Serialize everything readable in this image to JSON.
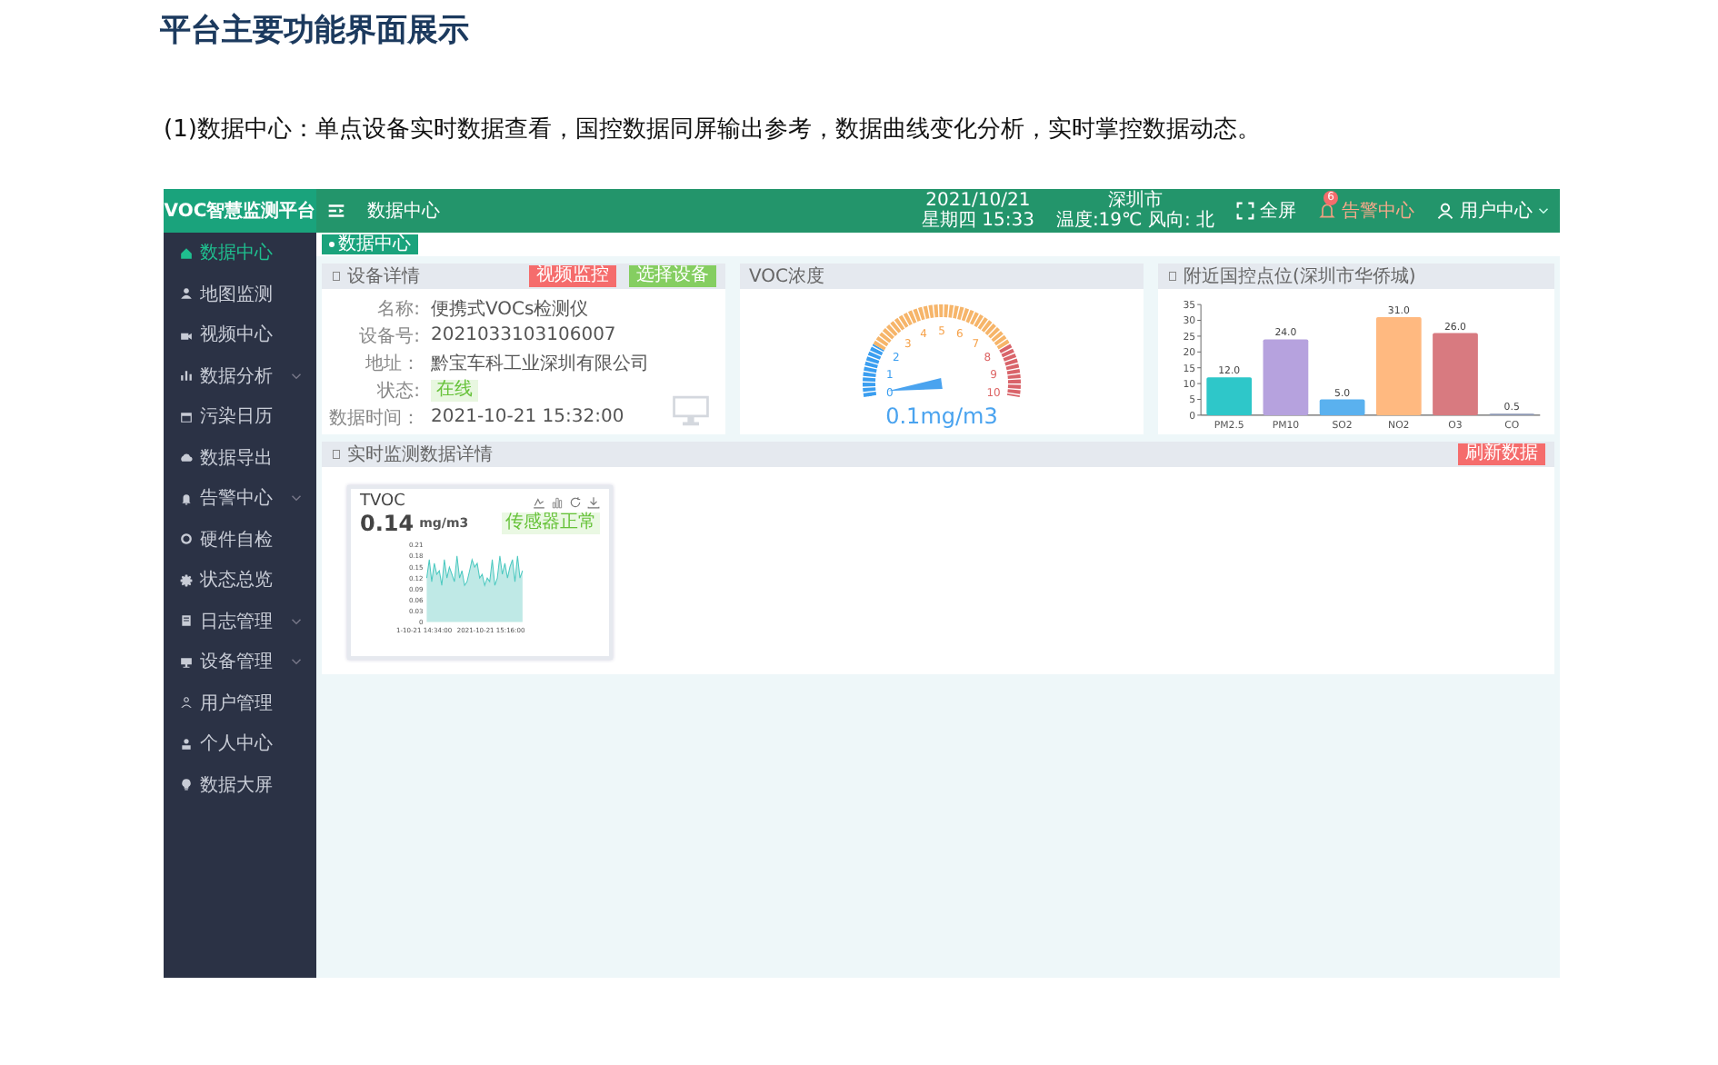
{
  "heading": "平台主要功能界面展示",
  "intro": "(1)数据中心：单点设备实时数据查看，国控数据同屏输出参考，数据曲线变化分析，实时掌控数据动态。",
  "app": {
    "logo": "VOC智慧监测平台",
    "page_title": "数据中心",
    "date": "2021/10/21",
    "weekday_time": "星期四 15:33",
    "city": "深圳市",
    "weather": "温度:19℃ 风向: 北",
    "fullscreen": "全屏",
    "alarm": {
      "label": "告警中心",
      "badge": "6"
    },
    "user": "用户中心",
    "sidebar": [
      {
        "label": "数据中心",
        "selected": true,
        "expandable": false
      },
      {
        "label": "地图监测",
        "selected": false,
        "expandable": false
      },
      {
        "label": "视频中心",
        "selected": false,
        "expandable": false
      },
      {
        "label": "数据分析",
        "selected": false,
        "expandable": true
      },
      {
        "label": "污染日历",
        "selected": false,
        "expandable": false
      },
      {
        "label": "数据导出",
        "selected": false,
        "expandable": false
      },
      {
        "label": "告警中心",
        "selected": false,
        "expandable": true
      },
      {
        "label": "硬件自检",
        "selected": false,
        "expandable": false
      },
      {
        "label": "状态总览",
        "selected": false,
        "expandable": false
      },
      {
        "label": "日志管理",
        "selected": false,
        "expandable": true
      },
      {
        "label": "设备管理",
        "selected": false,
        "expandable": true
      },
      {
        "label": "用户管理",
        "selected": false,
        "expandable": false
      },
      {
        "label": "个人中心",
        "selected": false,
        "expandable": false
      },
      {
        "label": "数据大屏",
        "selected": false,
        "expandable": false
      }
    ],
    "breadcrumb": "数据中心",
    "device_panel": {
      "title": "设备详情",
      "buttons": [
        {
          "label": "视频监控",
          "kind": "danger"
        },
        {
          "label": "选择设备",
          "kind": "success"
        }
      ],
      "fields": [
        {
          "label": "名称:",
          "value": "便携式VOCs检测仪",
          "kind": "text"
        },
        {
          "label": "设备号:",
          "value": "2021033103106007",
          "kind": "text"
        },
        {
          "label": "地址：",
          "value": "黔宝车科工业深圳有限公司",
          "kind": "text"
        },
        {
          "label": "状态:",
          "value": "在线",
          "kind": "tag"
        },
        {
          "label": "数据时间：",
          "value": "2021-10-21 15:32:00",
          "kind": "text"
        }
      ]
    },
    "gauge_panel": {
      "title": "VOC浓度",
      "ticks": [
        "0",
        "1",
        "2",
        "3",
        "4",
        "5",
        "6",
        "7",
        "8",
        "9",
        "10"
      ],
      "level": 0.01,
      "reading": "0.1mg/m3"
    },
    "station_panel": {
      "title": "附近国控点位(深圳市华侨城)",
      "chart_data": {
        "type": "bar",
        "categories": [
          "PM2.5",
          "PM10",
          "SO2",
          "NO2",
          "O3",
          "CO"
        ],
        "values": [
          12.0,
          24.0,
          5.0,
          31.0,
          26.0,
          0.5
        ],
        "colors": [
          "#2ec7c9",
          "#b6a2de",
          "#5ab1ef",
          "#ffb980",
          "#d87a80",
          "#8d98b3"
        ],
        "value_labels": [
          "12.0",
          "24.0",
          "5.0",
          "31.0",
          "26.0",
          "0.5"
        ],
        "ylim": [
          0,
          35
        ],
        "yticks": [
          0,
          5,
          10,
          15,
          20,
          25,
          30,
          35
        ],
        "data_labels": true
      }
    },
    "realtime_panel": {
      "title": "实时监测数据详情",
      "refresh_button": "刷新数据",
      "cards": [
        {
          "name": "TVOC",
          "value": "0.14",
          "unit": "mg/m3",
          "status": "传感器正常",
          "y_labels": [
            "0.21",
            "0.18",
            "0.15",
            "0.12",
            "0.09",
            "0.06",
            "0.03",
            "0"
          ],
          "x_labels": [
            "1-10-21 14:34:00",
            "2021-10-21 15:16:00"
          ]
        }
      ]
    }
  }
}
